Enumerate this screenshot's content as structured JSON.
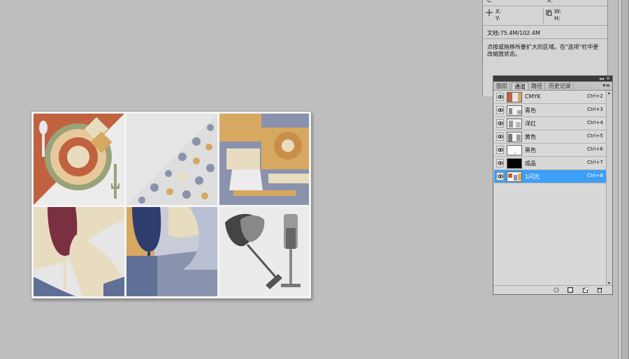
{
  "info": {
    "top_row_left": "C:",
    "top_row_right": "X:",
    "x_label": "X:",
    "y_label": "Y:",
    "w_label": "W:",
    "h_label": "H:",
    "doc_size": "文档:75.4M/102.4M",
    "hint": "点按或拖移所要扩大的区域。在\"选项\"栏中更改缩放状态。"
  },
  "panel": {
    "tabs": [
      "图层",
      "通道",
      "路径",
      "历史记录"
    ],
    "active_tab": "通道",
    "channels": [
      {
        "name": "CMYK",
        "shortcut": "Ctrl+2",
        "selected": false,
        "thumb": "color"
      },
      {
        "name": "青色",
        "shortcut": "Ctrl+3",
        "selected": false,
        "thumb": "gray"
      },
      {
        "name": "洋红",
        "shortcut": "Ctrl+4",
        "selected": false,
        "thumb": "gray"
      },
      {
        "name": "黄色",
        "shortcut": "Ctrl+5",
        "selected": false,
        "thumb": "gray"
      },
      {
        "name": "黑色",
        "shortcut": "Ctrl+6",
        "selected": false,
        "thumb": "white"
      },
      {
        "name": "成品",
        "shortcut": "Ctrl+7",
        "selected": false,
        "thumb": "black"
      },
      {
        "name": "1闪光",
        "shortcut": "Ctrl+8",
        "selected": true,
        "thumb": "color"
      }
    ],
    "footer_icons": [
      "load-selection-icon",
      "save-selection-icon",
      "new-channel-icon",
      "delete-channel-icon"
    ]
  },
  "colors": {
    "canvas_bg": "#bebebe",
    "selected_row": "#3d9ff5",
    "rust": "#c0623f",
    "tan": "#d6a860",
    "slate": "#8a92ad",
    "navy": "#2e3d6e",
    "wine": "#7a3040",
    "sage": "#9aa27a",
    "cream": "#e8dcc0"
  }
}
